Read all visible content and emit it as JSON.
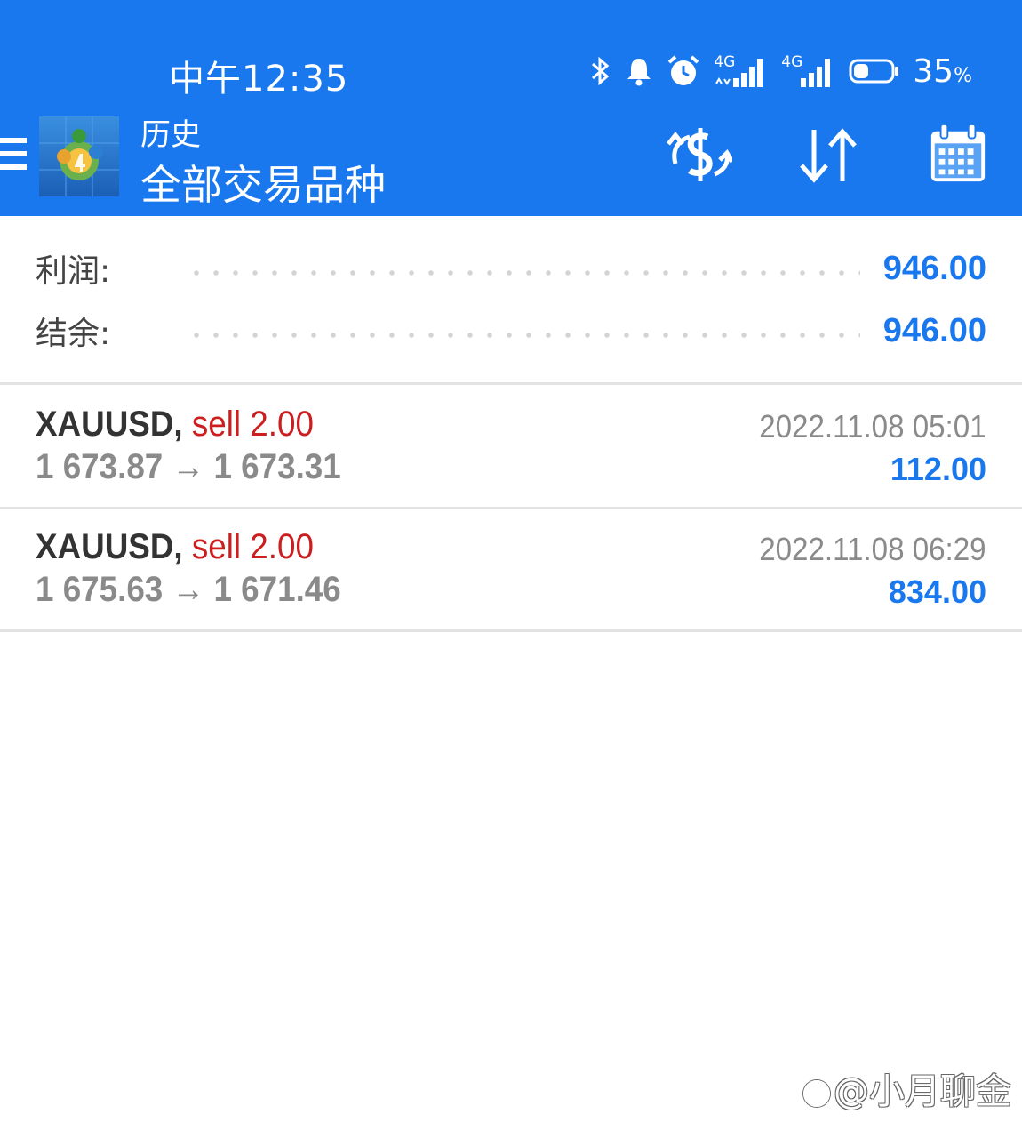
{
  "status_bar": {
    "time": "中午12:35",
    "network_1": "4G",
    "network_2": "4G",
    "battery_percent": "35",
    "battery_unit": "%",
    "battery_level": 0.35
  },
  "header": {
    "subtitle": "历史",
    "title": "全部交易品种",
    "background_color": "#1a78ef"
  },
  "toolbar": {
    "icons": [
      "history-filter-icon",
      "sort-icon",
      "calendar-icon"
    ]
  },
  "summary": {
    "profit_label": "利润:",
    "profit_value": "946.00",
    "balance_label": "结余:",
    "balance_value": "946.00"
  },
  "trades": [
    {
      "symbol": "XAUUSD,",
      "side": "sell 2.00",
      "prices": "1 673.87 → 1 673.31",
      "time": "2022.11.08 05:01",
      "profit": "112.00"
    },
    {
      "symbol": "XAUUSD,",
      "side": "sell 2.00",
      "prices": "1 675.63 → 1 671.46",
      "time": "2022.11.08 06:29",
      "profit": "834.00"
    }
  ],
  "watermark": "@小月聊金",
  "colors": {
    "accent": "#1a78ef",
    "sell": "#cc1e1e",
    "muted": "#8a8a8a"
  }
}
